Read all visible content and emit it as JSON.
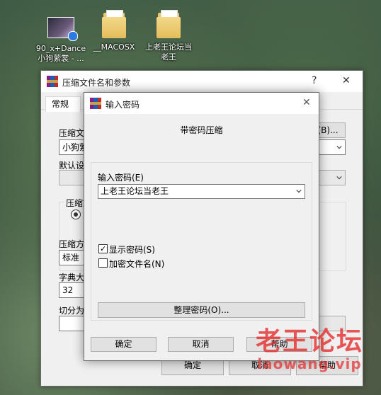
{
  "desktop": {
    "icons": [
      {
        "label_line1": "90_x+Dance",
        "label_line2": "小狗萦裳 - ...",
        "type": "video-thumbnail"
      },
      {
        "label_line1": "__MACOSX",
        "label_line2": "",
        "type": "folder"
      },
      {
        "label_line1": "上老王论坛当",
        "label_line2": "老王",
        "type": "folder"
      }
    ]
  },
  "back_window": {
    "title": "压缩文件名和参数",
    "help_glyph": "?",
    "close_glyph": "✕",
    "tab": "常规",
    "filename_label": "压缩文",
    "filename_value": "小狗萦",
    "browse_label": "(B)...",
    "default_label": "默认设",
    "group_label": "压缩文",
    "method_label": "压缩方",
    "method_value": "标准",
    "dict_label": "字典大",
    "dict_value": "32",
    "split_label": "切分为",
    "ok": "确定",
    "cancel": "取消",
    "help": "帮助"
  },
  "password_dialog": {
    "title": "输入密码",
    "close_glyph": "✕",
    "heading": "带密码压缩",
    "enter_label": "输入密码(E)",
    "password_value": "上老王论坛当老王",
    "show_password": {
      "label": "显示密码(S)",
      "checked": true
    },
    "encrypt_names": {
      "label": "加密文件名(N)",
      "checked": false
    },
    "organize_button": "整理密码(O)...",
    "ok": "确定",
    "cancel": "取消",
    "help": "帮助"
  },
  "watermark": {
    "main": "老王论坛",
    "sub": "laowang.vip"
  },
  "colors": {
    "dialog_bg": "#f0f0f0",
    "watermark": "#e62828",
    "folder": "#e7c66c"
  }
}
